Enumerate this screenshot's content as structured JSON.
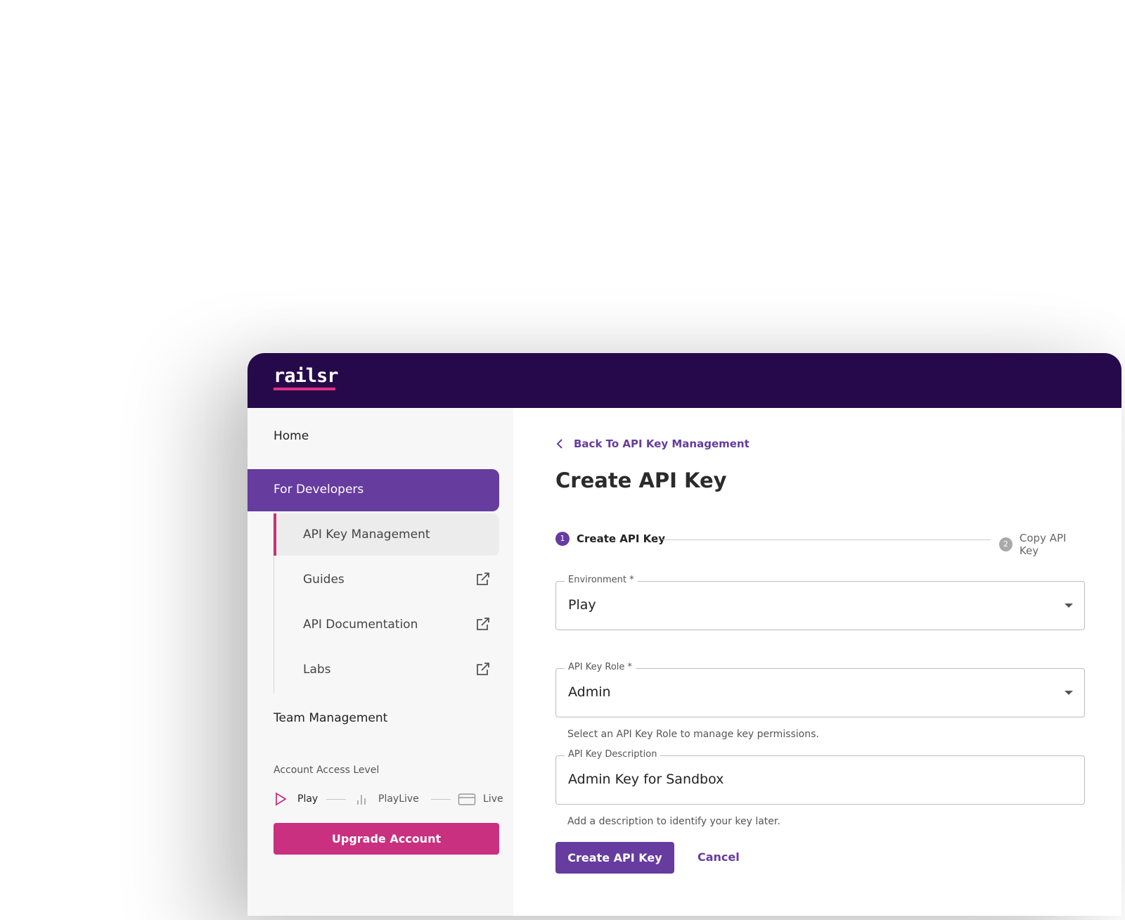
{
  "brand": {
    "logo_text": "railsr",
    "accent_color": "#e0307f",
    "header_color": "#26094a"
  },
  "sidebar": {
    "home": "Home",
    "for_developers": "For Developers",
    "sub_items": [
      {
        "label": "API Key Management",
        "active": true
      },
      {
        "label": "Guides",
        "icon": "external-link-icon"
      },
      {
        "label": "API Documentation",
        "icon": "external-link-icon"
      },
      {
        "label": "Labs",
        "icon": "external-link-icon"
      }
    ],
    "team_management": "Team Management",
    "access": {
      "title": "Account Access Level",
      "levels": [
        {
          "label": "Play",
          "icon": "play-icon",
          "current": true
        },
        {
          "label": "PlayLive",
          "icon": "bars-icon"
        },
        {
          "label": "Live",
          "icon": "card-icon"
        }
      ]
    },
    "upgrade_button": "Upgrade Account"
  },
  "main": {
    "back_link": "Back To API Key Management",
    "title": "Create API Key",
    "steps": [
      {
        "number": "1",
        "label": "Create API Key",
        "active": true
      },
      {
        "number": "2",
        "label": "Copy API Key",
        "active": false
      }
    ],
    "environment": {
      "label": "Environment *",
      "value": "Play"
    },
    "role": {
      "label": "API Key Role *",
      "value": "Admin",
      "helper": "Select an API Key Role to manage key permissions."
    },
    "description": {
      "label": "API Key Description",
      "value": "Admin Key for Sandbox",
      "helper": "Add a description to identify your key later."
    },
    "submit_button": "Create API Key",
    "cancel_button": "Cancel"
  }
}
